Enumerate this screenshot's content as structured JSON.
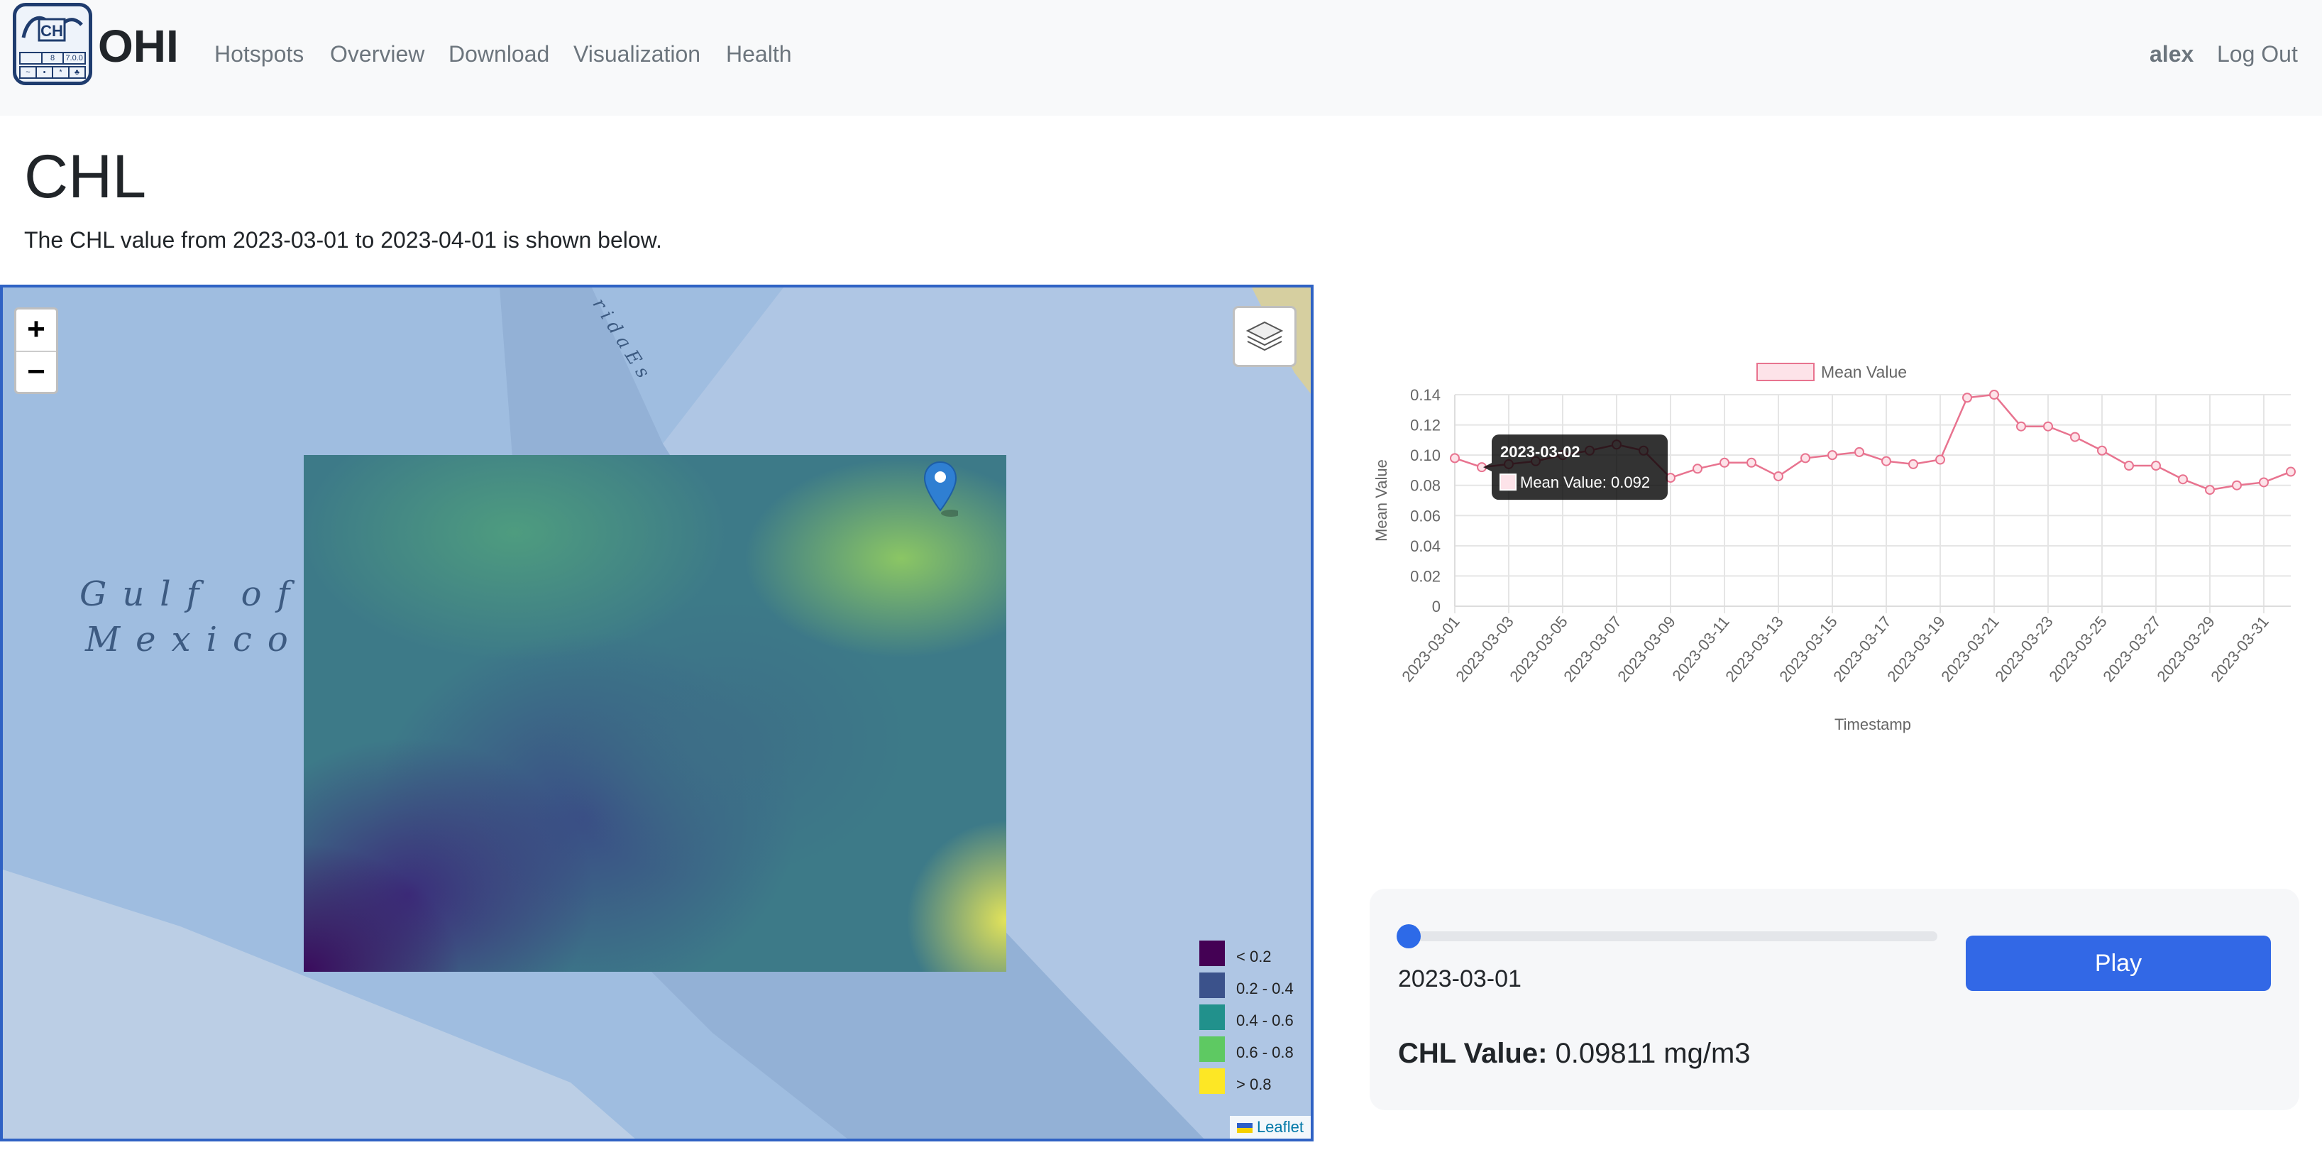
{
  "brand": {
    "name": "OHI",
    "logo_badges": [
      "8",
      "7.0.0"
    ]
  },
  "nav": {
    "links": [
      "Hotspots",
      "Overview",
      "Download",
      "Visualization",
      "Health"
    ],
    "user": "alex",
    "logout": "Log Out"
  },
  "page": {
    "title": "CHL",
    "description": "The CHL value from 2023-03-01 to 2023-04-01 is shown below."
  },
  "map": {
    "zoom_in": "+",
    "zoom_out": "−",
    "labels": {
      "gulf_line1": "Gulf of",
      "gulf_line2": "Mexico",
      "florida": "r i d a   E s"
    },
    "legend": [
      {
        "label": "< 0.2",
        "color": "#440154"
      },
      {
        "label": "0.2 - 0.4",
        "color": "#3b528b"
      },
      {
        "label": "0.4 - 0.6",
        "color": "#21918c"
      },
      {
        "label": "0.6 - 0.8",
        "color": "#5ec962"
      },
      {
        "label": "> 0.8",
        "color": "#fde725"
      }
    ],
    "attribution": "Leaflet"
  },
  "chart_data": {
    "type": "line",
    "legend": "Mean Value",
    "xlabel": "Timestamp",
    "ylabel": "Mean Value",
    "ylim": [
      0,
      0.14
    ],
    "yticks": [
      "0",
      "0.02",
      "0.04",
      "0.06",
      "0.08",
      "0.10",
      "0.12",
      "0.14"
    ],
    "xtick_labels": [
      "2023-03-01",
      "2023-03-03",
      "2023-03-05",
      "2023-03-07",
      "2023-03-09",
      "2023-03-11",
      "2023-03-13",
      "2023-03-15",
      "2023-03-17",
      "2023-03-19",
      "2023-03-21",
      "2023-03-23",
      "2023-03-25",
      "2023-03-27",
      "2023-03-29",
      "2023-03-31"
    ],
    "x": [
      "2023-03-01",
      "2023-03-02",
      "2023-03-03",
      "2023-03-04",
      "2023-03-05",
      "2023-03-06",
      "2023-03-07",
      "2023-03-08",
      "2023-03-09",
      "2023-03-10",
      "2023-03-11",
      "2023-03-12",
      "2023-03-13",
      "2023-03-14",
      "2023-03-15",
      "2023-03-16",
      "2023-03-17",
      "2023-03-18",
      "2023-03-19",
      "2023-03-20",
      "2023-03-21",
      "2023-03-22",
      "2023-03-23",
      "2023-03-24",
      "2023-03-25",
      "2023-03-26",
      "2023-03-27",
      "2023-03-28",
      "2023-03-29",
      "2023-03-30",
      "2023-03-31",
      "2023-04-01"
    ],
    "values": [
      0.098,
      0.092,
      0.094,
      0.096,
      0.1,
      0.103,
      0.107,
      0.103,
      0.085,
      0.091,
      0.095,
      0.095,
      0.086,
      0.098,
      0.1,
      0.102,
      0.096,
      0.094,
      0.097,
      0.138,
      0.14,
      0.119,
      0.119,
      0.112,
      0.103,
      0.093,
      0.093,
      0.084,
      0.077,
      0.08,
      0.082,
      0.089
    ],
    "tooltip": {
      "title": "2023-03-02",
      "label": "Mean Value: 0.092"
    },
    "color": "#e8738f"
  },
  "player": {
    "date": "2023-03-01",
    "progress": 0,
    "play_label": "Play",
    "value_label": "CHL Value:",
    "value": "0.09811 mg/m3"
  }
}
